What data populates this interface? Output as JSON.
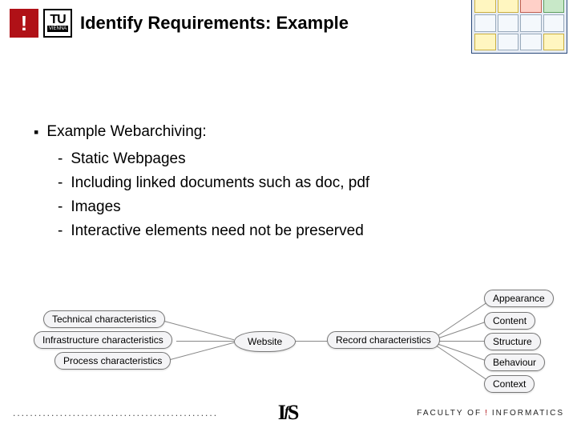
{
  "header": {
    "title": "Identify Requirements: Example",
    "logo_letter": "!",
    "logo_tu_top": "TU",
    "logo_tu_bottom": "VIENNA"
  },
  "content": {
    "heading": "Example Webarchiving:",
    "items": [
      "Static Webpages",
      "Including linked documents such as doc, pdf",
      "Images",
      "Interactive elements need not be preserved"
    ]
  },
  "map": {
    "center": "Website",
    "left": [
      "Technical characteristics",
      "Infrastructure characteristics",
      "Process characteristics"
    ],
    "record_label": "Record characteristics",
    "right": [
      "Appearance",
      "Content",
      "Structure",
      "Behaviour",
      "Context"
    ]
  },
  "footer": {
    "dots": "................................................",
    "ifs_i": "I",
    "ifs_f": "f",
    "ifs_s": "S",
    "faculty_pre": "FACULTY  OF ",
    "faculty_bang": "!",
    "faculty_word": "INFORMATICS"
  }
}
